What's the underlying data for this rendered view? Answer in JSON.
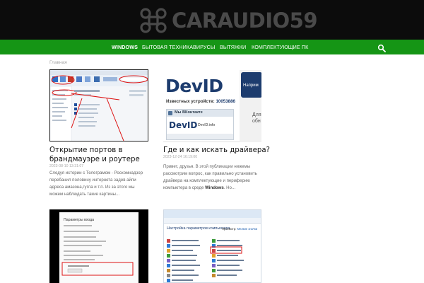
{
  "site": {
    "logo_text": "CARAUDIO59"
  },
  "nav": {
    "items": [
      {
        "label": "WINDOWS",
        "active": true
      },
      {
        "label": "БЫТОВАЯ ТЕХНИКА",
        "active": false
      },
      {
        "label": "ВИРУСЫ",
        "active": false
      },
      {
        "label": "ВЫТЯЖКИ",
        "active": false
      },
      {
        "label": "КОМПЛЕКТУЮЩИЕ ПК",
        "active": false
      }
    ]
  },
  "breadcrumb": {
    "home": "Главная"
  },
  "posts": [
    {
      "title_line1": "Открытие портов в",
      "title_line2": "брандмауэре и роутере",
      "date": "2023-08-10 13:31:07",
      "excerpt_line1": "Следуя истории с Телеграмом - Роскомнадзор",
      "excerpt_line2": "перебанил половину интернета задев айпи",
      "excerpt_line3": "адреса амазона,гугла и т.п. Из за этого мы",
      "excerpt_line4": "можем наблюдать такие картины..."
    },
    {
      "title_line1": "Где и как искать драйвера?",
      "date": "2023-12-24 16:19:00",
      "excerpt_line1": "Привет, друзья. В этой публикации нижемы",
      "excerpt_line2": "рассмотрим вопрос, как правильно установить",
      "excerpt_line3": "драйвера на комплектующие и периферию",
      "excerpt_line4a": "компьютера в среде ",
      "excerpt_line4b": "Windows",
      "excerpt_line4c": ". Но...",
      "thumb": {
        "brand": "DevID",
        "devices_label": "Известных устройств:",
        "devices_count": "10053886",
        "vk_label": "Мы ВКонтакте",
        "site_label": "DevID.info",
        "side_btn": "Наприм",
        "side_text1": "Для",
        "side_text2": "обн"
      }
    },
    {
      "thumb": {
        "header": "Параметры входа"
      }
    },
    {
      "thumb": {
        "header": "Настройка параметров компьютера",
        "view": "Просмотр:",
        "view_val": "Мелкие значки"
      }
    }
  ],
  "colors": {
    "header_bg": "#0c0c0c",
    "nav_bg": "#159515",
    "logo": "#4a4a4a",
    "devid_blue": "#1d3c6e"
  }
}
